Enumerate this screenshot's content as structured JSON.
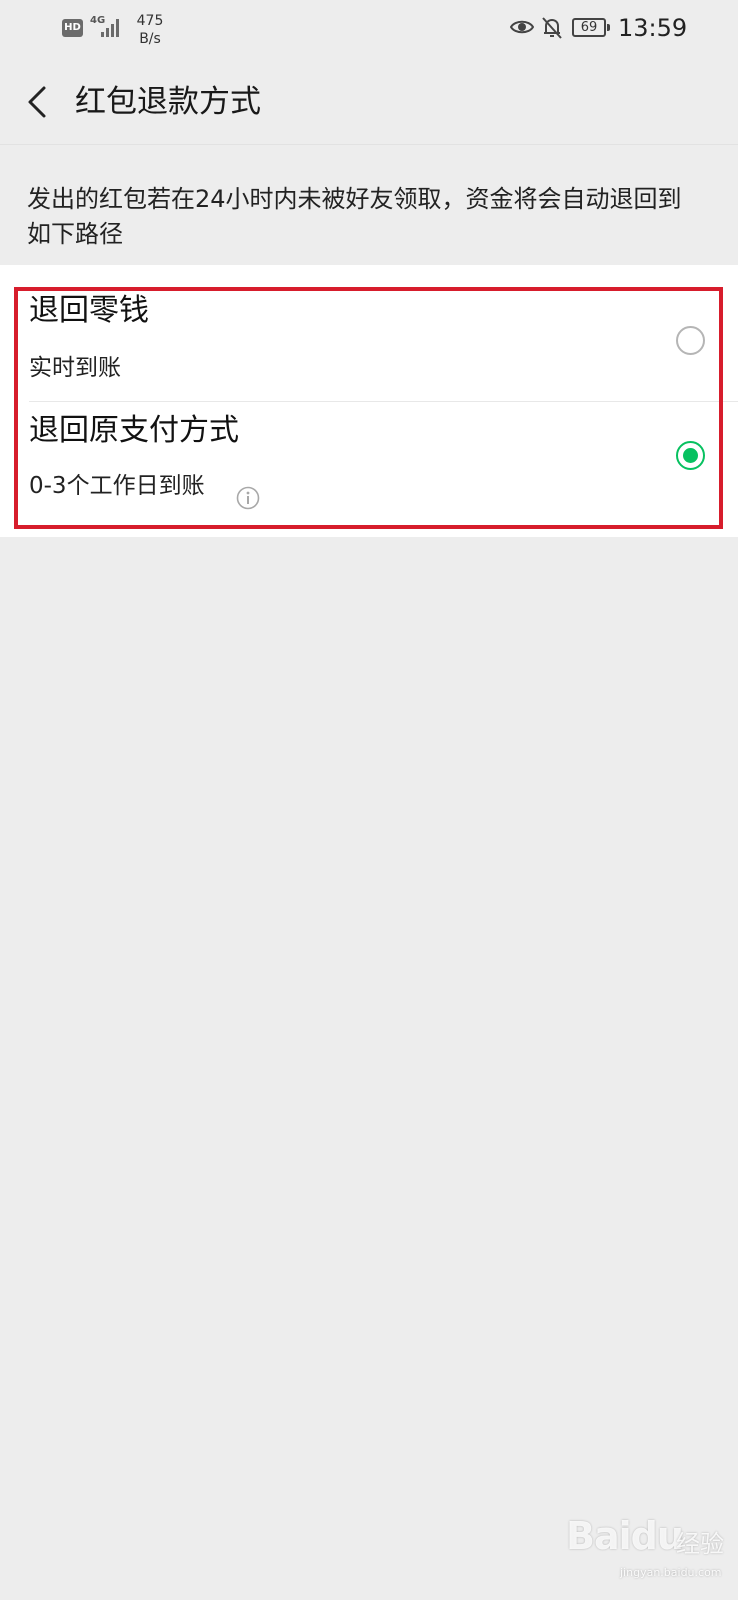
{
  "status_bar": {
    "hd": "HD",
    "network": "4G",
    "speed_value": "475",
    "speed_unit": "B/s",
    "battery": "69",
    "time": "13:59",
    "icons": [
      "signal-icon",
      "eye-icon",
      "bell-off-icon",
      "battery-icon"
    ]
  },
  "header": {
    "back_icon": "chevron-left-icon",
    "title": "红包退款方式"
  },
  "description": "发出的红包若在24小时内未被好友领取，资金将会自动退回到如下路径",
  "options": [
    {
      "title": "退回零钱",
      "subtitle": "实时到账",
      "selected": false
    },
    {
      "title": "退回原支付方式",
      "subtitle": "0-3个工作日到账",
      "selected": true,
      "info_icon": "info-icon"
    }
  ],
  "colors": {
    "page_bg": "#ededed",
    "card_bg": "#ffffff",
    "accent_green": "#07c160",
    "highlight_red": "#d71d2c"
  },
  "watermark": {
    "brand": "Baidu",
    "brand_cn": "经验",
    "url": "jingyan.baidu.com"
  }
}
